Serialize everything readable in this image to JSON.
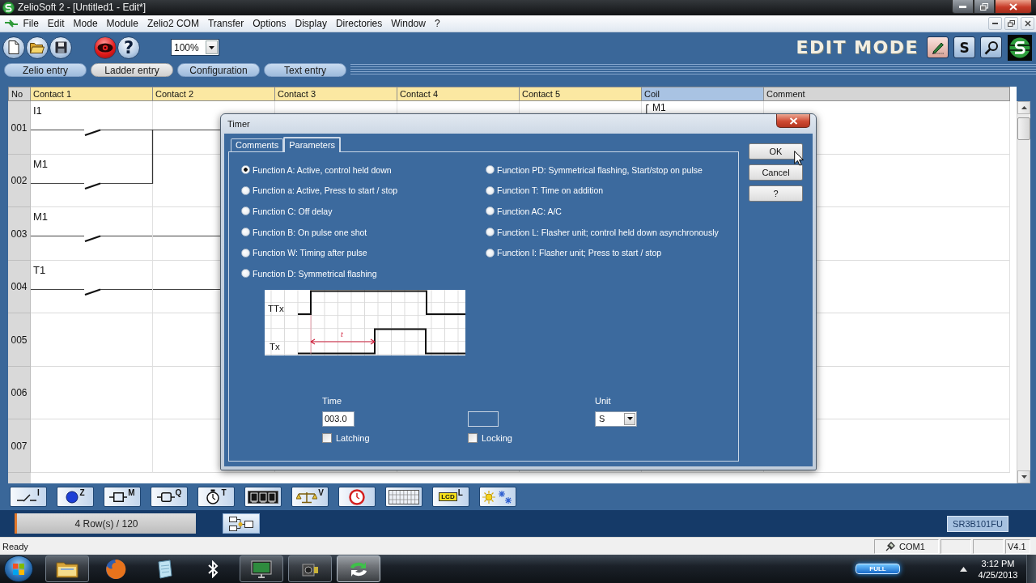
{
  "window": {
    "title": "ZelioSoft 2 - [Untitled1 - Edit*]"
  },
  "menu": [
    "File",
    "Edit",
    "Mode",
    "Module",
    "Zelio2 COM",
    "Transfer",
    "Options",
    "Display",
    "Directories",
    "Window",
    "?"
  ],
  "toolbar": {
    "help_label": "?",
    "zoom": "100%",
    "mode_label": "EDIT MODE",
    "mode_buttons": [
      {
        "kind": "edit",
        "selected": true
      },
      {
        "kind": "letter",
        "label": "S",
        "selected": false
      },
      {
        "kind": "search",
        "selected": false
      }
    ]
  },
  "entry_tabs": [
    {
      "label": "Zelio entry",
      "selected": false
    },
    {
      "label": "Ladder entry",
      "selected": true
    },
    {
      "label": "Configuration",
      "selected": false
    },
    {
      "label": "Text entry",
      "selected": false
    }
  ],
  "ladder": {
    "columns": [
      {
        "label": "No",
        "kind": "number"
      },
      {
        "label": "Contact 1",
        "kind": "contact"
      },
      {
        "label": "Contact 2",
        "kind": "contact"
      },
      {
        "label": "Contact 3",
        "kind": "contact"
      },
      {
        "label": "Contact 4",
        "kind": "contact"
      },
      {
        "label": "Contact 5",
        "kind": "contact"
      },
      {
        "label": "Coil",
        "kind": "coil"
      },
      {
        "label": "Comment",
        "kind": "comment"
      }
    ],
    "rows": [
      {
        "number": "001",
        "cells": [
          {
            "kind": "contact",
            "label": "I1",
            "branch_up": false
          },
          {
            "kind": "wire"
          }
        ],
        "coil": {
          "label": "M1"
        }
      },
      {
        "number": "002",
        "cells": [
          {
            "kind": "contact",
            "label": "M1",
            "branch_up": true
          }
        ]
      },
      {
        "number": "003",
        "cells": [
          {
            "kind": "contact",
            "label": "M1",
            "branch_up": false
          },
          {
            "kind": "wire"
          }
        ]
      },
      {
        "number": "004",
        "cells": [
          {
            "kind": "contact",
            "label": "T1",
            "branch_up": false
          },
          {
            "kind": "wire"
          }
        ]
      },
      {
        "number": "005"
      },
      {
        "number": "006"
      },
      {
        "number": "007"
      }
    ]
  },
  "timer_dialog": {
    "title": "Timer",
    "tabs": [
      {
        "label": "Comments",
        "selected": false
      },
      {
        "label": "Parameters",
        "selected": true
      }
    ],
    "functions": [
      {
        "label": "Function A: Active, control held down",
        "selected": true
      },
      {
        "label": "Function a: Active, Press to start / stop",
        "selected": false
      },
      {
        "label": "Function C: Off delay",
        "selected": false
      },
      {
        "label": "Function B: On pulse one shot",
        "selected": false
      },
      {
        "label": "Function W: Timing after pulse",
        "selected": false
      },
      {
        "label": "Function D: Symmetrical flashing",
        "selected": false
      },
      {
        "label": "Function PD: Symmetrical flashing, Start/stop on pulse",
        "selected": false
      },
      {
        "label": "Function T: Time on addition",
        "selected": false
      },
      {
        "label": "Function AC: A/C",
        "selected": false
      },
      {
        "label": "Function L: Flasher unit; control held down asynchronously",
        "selected": false
      },
      {
        "label": "Function I: Flasher unit; Press to start / stop",
        "selected": false
      }
    ],
    "timing_diagram": {
      "signals": [
        "TTx",
        "Tx"
      ],
      "duration_label": "t"
    },
    "time": {
      "label": "Time",
      "value": "003.0"
    },
    "second_field": {
      "disabled": true
    },
    "unit": {
      "label": "Unit",
      "value": "S"
    },
    "checkboxes": [
      {
        "label": "Latching",
        "checked": false
      },
      {
        "label": "Locking",
        "checked": false
      }
    ],
    "buttons": [
      "OK",
      "Cancel",
      "?"
    ]
  },
  "palette": [
    {
      "kind": "contact",
      "letter": "I"
    },
    {
      "kind": "dot",
      "letter": "Z"
    },
    {
      "kind": "relay",
      "letter": "M"
    },
    {
      "kind": "output",
      "letter": "Q"
    },
    {
      "kind": "timer",
      "letter": "T"
    },
    {
      "kind": "counter"
    },
    {
      "kind": "compare",
      "letter": "V"
    },
    {
      "kind": "clock"
    },
    {
      "kind": "text"
    },
    {
      "kind": "lcd",
      "tile": "LCD",
      "letter": "L"
    },
    {
      "kind": "season"
    }
  ],
  "status": {
    "rows": "4 Row(s) / 120",
    "module": "SR3B101FU"
  },
  "status_bar": {
    "message": "Ready",
    "port": "COM1",
    "version": "V4.1"
  },
  "taskbar": {
    "apps": [
      {
        "kind": "folder",
        "running": true,
        "selected": false
      },
      {
        "kind": "browser",
        "running": false,
        "selected": false
      },
      {
        "kind": "notepad",
        "running": false,
        "selected": false
      },
      {
        "kind": "bluetooth",
        "running": false,
        "selected": false
      },
      {
        "kind": "monitor",
        "running": true,
        "selected": false
      },
      {
        "kind": "camera",
        "running": true,
        "selected": false
      },
      {
        "kind": "zelio",
        "running": true,
        "selected": true
      }
    ],
    "battery": "FULL",
    "time": "3:12 PM",
    "date": "4/25/2013"
  }
}
